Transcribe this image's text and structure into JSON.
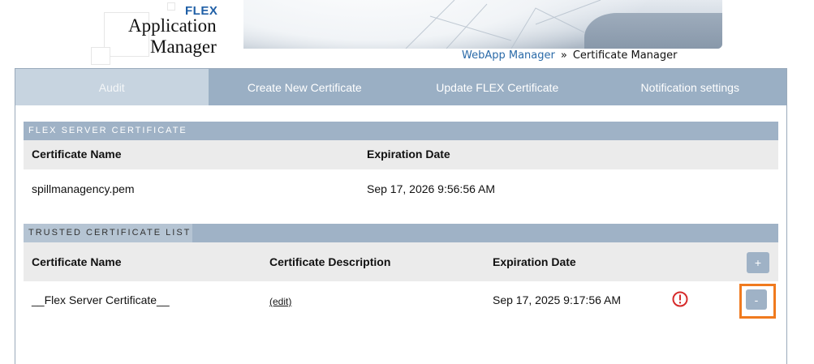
{
  "logo": {
    "flex": "FLEX",
    "line1": "Application",
    "line2": "Manager"
  },
  "breadcrumb": {
    "link": "WebApp Manager",
    "separator": "»",
    "current": "Certificate Manager"
  },
  "tabs": [
    {
      "label": "Audit",
      "active": true
    },
    {
      "label": "Create New Certificate",
      "active": false
    },
    {
      "label": "Update FLEX Certificate",
      "active": false
    },
    {
      "label": "Notification settings",
      "active": false
    }
  ],
  "server_certificate": {
    "section_title": "FLEX SERVER CERTIFICATE",
    "headers": {
      "name": "Certificate Name",
      "expiration": "Expiration Date"
    },
    "row": {
      "name": "spillmanagency.pem",
      "expiration": "Sep 17, 2026 9:56:56 AM"
    }
  },
  "trusted_list": {
    "section_title": "TRUSTED CERTIFICATE LIST",
    "headers": {
      "name": "Certificate Name",
      "description": "Certificate Description",
      "expiration": "Expiration Date"
    },
    "add_label": "+",
    "rows": [
      {
        "name": "__Flex Server Certificate__",
        "description_link": "(edit)",
        "expiration": "Sep 17, 2025 9:17:56 AM",
        "status_icon": "warning-circle-icon",
        "remove_label": "-"
      }
    ]
  },
  "colors": {
    "tab_bar": "#9aafc4",
    "active_tab": "#c7d4e0",
    "section_header": "#9fb2c6",
    "warning": "#d62a2a",
    "highlight": "#f07a1e",
    "link": "#2a6aa8"
  }
}
